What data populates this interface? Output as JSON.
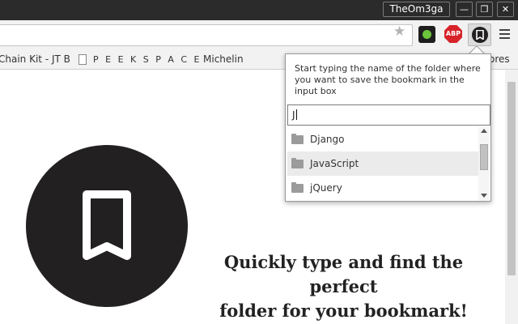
{
  "window": {
    "profile_name": "TheOm3ga",
    "minimize_glyph": "—",
    "maximize_glyph": "❐",
    "close_glyph": "✕"
  },
  "toolbar": {
    "star_glyph": "★",
    "extensions": [
      {
        "name": "green-dot-extension",
        "icon": "green-dot-icon"
      },
      {
        "name": "adblock-plus-extension",
        "label": "ABP"
      },
      {
        "name": "bookmark-extension",
        "icon": "bookmark-icon"
      }
    ],
    "menu_icon": "hamburger-menu-icon"
  },
  "bookmarks_bar": {
    "items": [
      {
        "label": "Chain Kit - JT B"
      },
      {
        "label": "P E E K S P A C E",
        "icon": "page-icon"
      },
      {
        "label": "Michelin"
      },
      {
        "label": "ores"
      }
    ]
  },
  "page": {
    "tagline": "Quickly type and find the perfect\nfolder for your bookmark!",
    "logo_icon": "bookmark-icon",
    "colors": {
      "logo_bg": "#222020",
      "text": "#222222"
    }
  },
  "popup": {
    "instructions": "Start typing the name of the folder where you want to save the bookmark in the input box",
    "input_value": "J",
    "folders": [
      {
        "label": "Django",
        "icon": "folder-icon",
        "selected": false
      },
      {
        "label": "JavaScript",
        "icon": "folder-icon",
        "selected": true
      },
      {
        "label": "jQuery",
        "icon": "folder-icon",
        "selected": false
      }
    ]
  }
}
